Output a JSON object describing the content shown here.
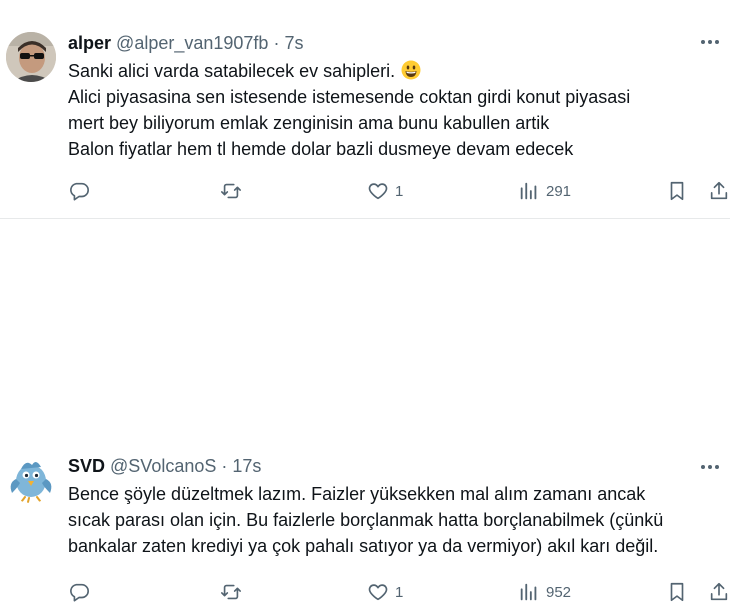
{
  "tweets": [
    {
      "name": "alper",
      "handle": "@alper_van1907fb",
      "separator": "·",
      "time": "7s",
      "lines": [
        "Sanki alici varda satabilecek ev sahipleri.",
        "Alici piyasasina sen istesende istemesende coktan girdi konut piyasasi",
        "mert bey biliyorum emlak zenginisin ama bunu kabullen artik",
        "Balon fiyatlar hem tl hemde dolar bazli dusmeye devam edecek"
      ],
      "emoji": "grinning-face",
      "reply_count": "",
      "retweet_count": "",
      "like_count": "1",
      "view_count": "291"
    },
    {
      "name": "SVD",
      "handle": "@SVolcanoS",
      "separator": "·",
      "time": "17s",
      "lines": [
        "Bence şöyle düzeltmek lazım. Faizler yüksekken mal alım zamanı ancak",
        "sıcak parası olan için. Bu faizlerle borçlanmak hatta borçlanabilmek (çünkü",
        "bankalar zaten krediyi ya çok pahalı satıyor ya da vermiyor) akıl karı değil."
      ],
      "reply_count": "",
      "retweet_count": "",
      "like_count": "1",
      "view_count": "952"
    }
  ],
  "colors": {
    "text": "#0f1419",
    "secondary": "#536471",
    "divider": "#e7e9ea"
  },
  "icons": [
    "reply-icon",
    "retweet-icon",
    "like-icon",
    "views-icon",
    "bookmark-icon",
    "share-icon",
    "more-icon"
  ]
}
